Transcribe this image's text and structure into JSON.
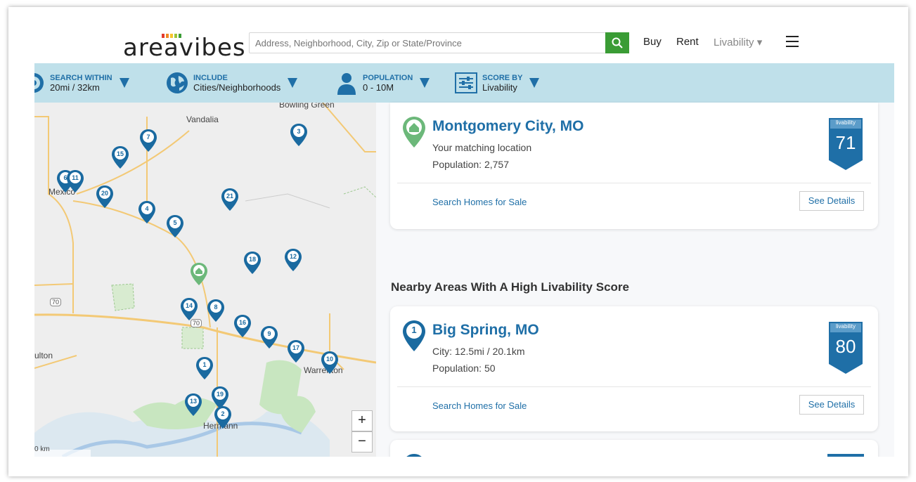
{
  "header": {
    "logo_text": "areavibes",
    "search_placeholder": "Address, Neighborhood, City, Zip or State/Province",
    "nav": {
      "buy": "Buy",
      "rent": "Rent",
      "livability": "Livability ▾"
    }
  },
  "filters": [
    {
      "title": "SEARCH WITHIN",
      "value": "20mi / 32km"
    },
    {
      "title": "INCLUDE",
      "value": "Cities/Neighborhoods"
    },
    {
      "title": "POPULATION",
      "value": "0 - 10M"
    },
    {
      "title": "SCORE BY",
      "value": "Livability"
    }
  ],
  "map": {
    "place_labels": {
      "vandalia": "Vandalia",
      "bowling_green": "Bowling Green",
      "mexico": "Mexico",
      "fulton": "ulton",
      "warrenton": "Warrenton",
      "hermann": "Hermann",
      "scale": "0 km"
    },
    "highway_labels": [
      "70",
      "70"
    ],
    "pins": [
      "1",
      "2",
      "3",
      "4",
      "5",
      "6",
      "7",
      "8",
      "9",
      "10",
      "11",
      "12",
      "13",
      "14",
      "15",
      "16",
      "17",
      "18",
      "19",
      "20",
      "21"
    ],
    "zoom_in": "+",
    "zoom_out": "−"
  },
  "main_card": {
    "title": "Montgomery City, MO",
    "subtitle": "Your matching location",
    "population": "Population: 2,757",
    "search_homes": "Search Homes for Sale",
    "see_details": "See Details",
    "badge_label": "livability",
    "score": "71"
  },
  "section_title": "Nearby Areas With A High Livability Score",
  "nearby": [
    {
      "rank": "1",
      "title": "Big Spring, MO",
      "distance": "City: 12.5mi / 20.1km",
      "population": "Population: 50",
      "search_homes": "Search Homes for Sale",
      "see_details": "See Details",
      "badge_label": "livability",
      "score": "80"
    }
  ],
  "colors": {
    "accent_blue": "#1f6fa7",
    "green": "#3a9c35",
    "filter_bar": "#bfe0ea",
    "home_pin": "#6cb87a"
  }
}
